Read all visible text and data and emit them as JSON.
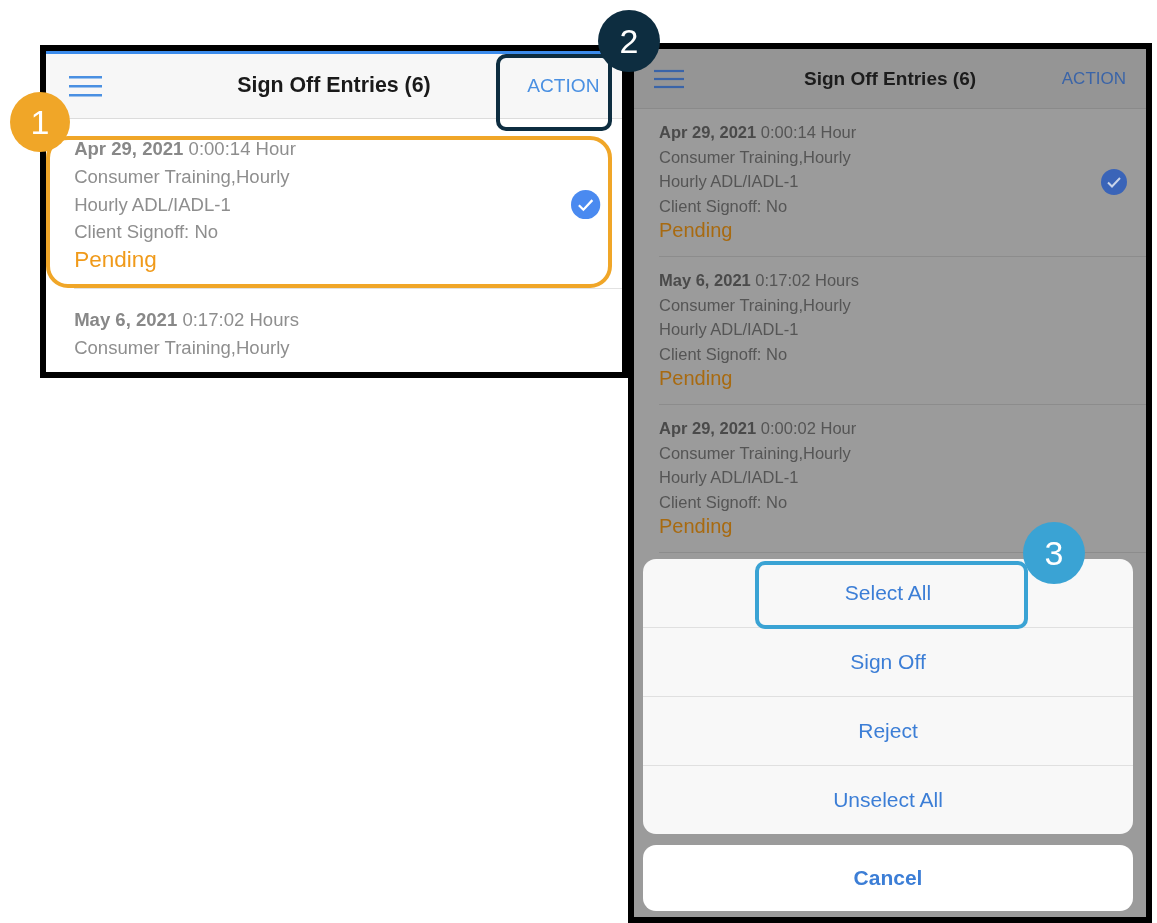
{
  "callouts": [
    {
      "label": "1",
      "color": "#f0a628"
    },
    {
      "label": "2",
      "color": "#0d2d40"
    },
    {
      "label": "3",
      "color": "#3aa3d4"
    }
  ],
  "screens": [
    {
      "dimmed": false,
      "header": {
        "title": "Sign Off Entries (6)",
        "action": "ACTION"
      },
      "entries": [
        {
          "date": "Apr 29, 2021",
          "duration": "0:00:14 Hour",
          "lines": [
            "Consumer Training,Hourly",
            "Hourly ADL/IADL-1",
            "Client Signoff: No"
          ],
          "status": "Pending",
          "selected": true
        },
        {
          "date": "May 6, 2021",
          "duration": "0:17:02 Hours",
          "lines": [
            "Consumer Training,Hourly"
          ],
          "selected": false
        }
      ]
    },
    {
      "dimmed": true,
      "header": {
        "title": "Sign Off Entries (6)",
        "action": "ACTION"
      },
      "entries": [
        {
          "date": "Apr 29, 2021",
          "duration": "0:00:14 Hour",
          "lines": [
            "Consumer Training,Hourly",
            "Hourly ADL/IADL-1",
            "Client Signoff: No"
          ],
          "status": "Pending",
          "selected": true
        },
        {
          "date": "May 6, 2021",
          "duration": "0:17:02 Hours",
          "lines": [
            "Consumer Training,Hourly",
            "Hourly ADL/IADL-1",
            "Client Signoff: No"
          ],
          "status": "Pending",
          "selected": false
        },
        {
          "date": "Apr 29, 2021",
          "duration": "0:00:02 Hour",
          "lines": [
            "Consumer Training,Hourly",
            "Hourly ADL/IADL-1",
            "Client Signoff: No"
          ],
          "status": "Pending",
          "selected": false
        }
      ],
      "action_sheet": {
        "items": [
          "Select All",
          "Sign Off",
          "Reject",
          "Unselect All"
        ],
        "cancel": "Cancel"
      }
    }
  ]
}
